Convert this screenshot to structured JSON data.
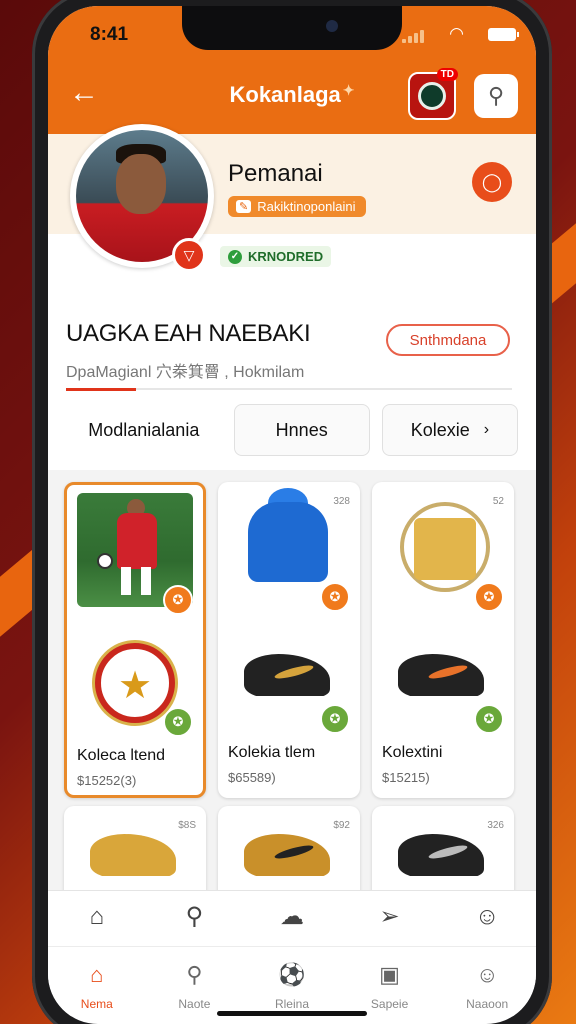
{
  "status": {
    "time": "8:41"
  },
  "header": {
    "title": "Kokanlaga",
    "badge_count": "TD"
  },
  "profile": {
    "name": "Pemanai",
    "tag": "Rakiktinoponlaini",
    "verified": "KRNODRED"
  },
  "section": {
    "title": "UAGKA EAH NAEBAKI",
    "subtitle": "DpaMagianl  穴桊箕罾 , Hokmilam",
    "action_label": "Snthmdana"
  },
  "tabs": [
    {
      "label": "Modlanialania"
    },
    {
      "label": "Hnnes"
    },
    {
      "label": "Kolexie"
    }
  ],
  "cards": [
    {
      "price_tag": ""
    },
    {
      "price_tag": "328"
    },
    {
      "price_tag": "52"
    },
    {
      "name": "Koleсa ltend",
      "price": "$15252(3)"
    },
    {
      "name": "Kolekia tlem",
      "price": "$65589)"
    },
    {
      "name": "Kolextini",
      "price": "$15215)"
    },
    {
      "price_tag": "$8S"
    },
    {
      "price_tag": "$92"
    },
    {
      "price_tag": "326"
    }
  ],
  "tabbar": {
    "items": [
      {
        "label": "Nema",
        "icon": "home-icon"
      },
      {
        "label": "Naote",
        "icon": "search-icon"
      },
      {
        "label": "Rleina",
        "icon": "ball-icon"
      },
      {
        "label": "Sapeie",
        "icon": "bag-icon"
      },
      {
        "label": "Naaoon",
        "icon": "user-icon"
      }
    ]
  },
  "colors": {
    "brand": "#ea6d12",
    "accent": "#e84d1a",
    "verified": "#2e9e3c"
  }
}
